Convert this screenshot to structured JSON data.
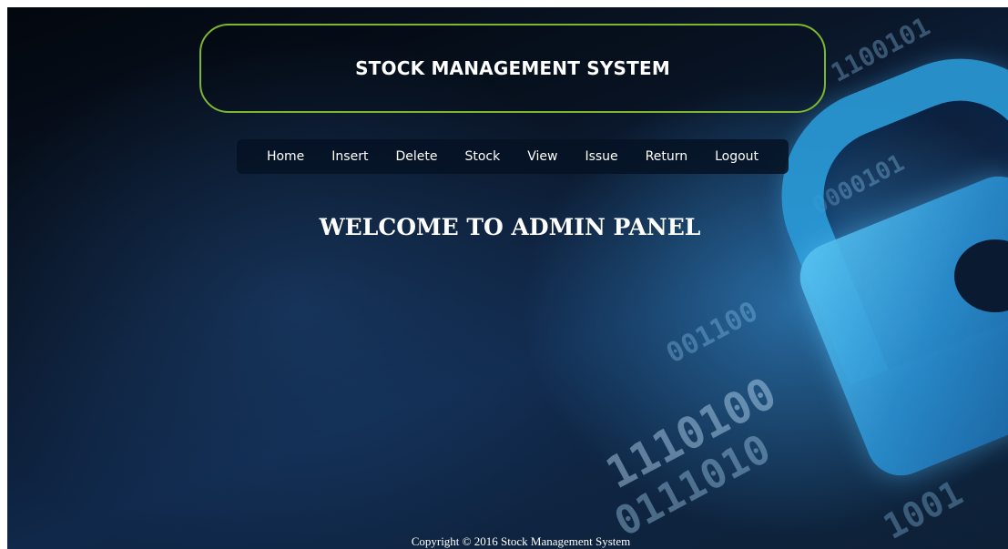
{
  "header": {
    "title": "STOCK MANAGEMENT SYSTEM"
  },
  "nav": {
    "items": [
      {
        "label": "Home"
      },
      {
        "label": "Insert"
      },
      {
        "label": "Delete"
      },
      {
        "label": "Stock"
      },
      {
        "label": "View"
      },
      {
        "label": "Issue"
      },
      {
        "label": "Return"
      },
      {
        "label": "Logout"
      }
    ]
  },
  "main": {
    "heading": "WELCOME TO ADMIN PANEL"
  },
  "footer": {
    "copyright": "Copyright © 2016 Stock Management System"
  },
  "colors": {
    "header_border": "#7fb630",
    "lock_accent": "#2a9bd8",
    "background_dark": "#0a1628"
  }
}
